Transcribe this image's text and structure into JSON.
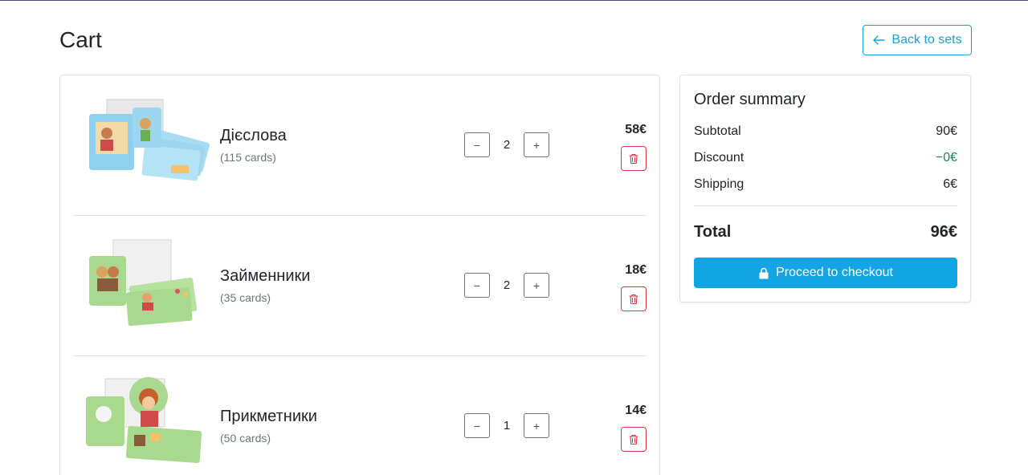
{
  "page": {
    "title": "Cart"
  },
  "nav": {
    "back_label": "Back to sets"
  },
  "cart": {
    "items": [
      {
        "name": "Дієслова",
        "count": "(115 cards)",
        "quantity": "2",
        "price": "58€",
        "qty_minus": "−",
        "qty_plus": "+",
        "icon": "blue-card-set"
      },
      {
        "name": "Займенники",
        "count": "(35 cards)",
        "quantity": "2",
        "price": "18€",
        "qty_minus": "−",
        "qty_plus": "+",
        "icon": "green-card-set"
      },
      {
        "name": "Прикметники",
        "count": "(50 cards)",
        "quantity": "1",
        "price": "14€",
        "qty_minus": "−",
        "qty_plus": "+",
        "icon": "green-card-set"
      }
    ]
  },
  "summary": {
    "title": "Order summary",
    "subtotal_label": "Subtotal",
    "subtotal_value": "90€",
    "discount_label": "Discount",
    "discount_value": "−0€",
    "shipping_label": "Shipping",
    "shipping_value": "6€",
    "total_label": "Total",
    "total_value": "96€",
    "checkout_label": "Proceed to checkout"
  },
  "colors": {
    "accent": "#13a5e3",
    "danger": "#dc3545",
    "success": "#198754"
  }
}
